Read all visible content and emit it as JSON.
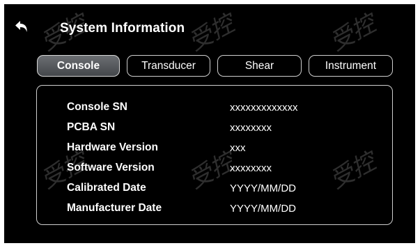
{
  "header": {
    "title": "System Information"
  },
  "tabs": [
    {
      "label": "Console",
      "active": true
    },
    {
      "label": "Transducer",
      "active": false
    },
    {
      "label": "Shear",
      "active": false
    },
    {
      "label": "Instrument",
      "active": false
    }
  ],
  "info": [
    {
      "label": "Console SN",
      "value": "xxxxxxxxxxxxx"
    },
    {
      "label": "PCBA SN",
      "value": "xxxxxxxx"
    },
    {
      "label": "Hardware Version",
      "value": "xxx"
    },
    {
      "label": "Software Version",
      "value": "xxxxxxxx"
    },
    {
      "label": "Calibrated Date",
      "value": "YYYY/MM/DD"
    },
    {
      "label": "Manufacturer Date",
      "value": "YYYY/MM/DD"
    }
  ],
  "watermark": {
    "text": "受控"
  },
  "colors": {
    "background": "#000000",
    "text": "#ffffff",
    "border": "#cfcfcf",
    "active_tab_top": "#6b6e72",
    "active_tab_bottom": "#44474b"
  },
  "icons": {
    "back": "back-arrow-icon"
  }
}
